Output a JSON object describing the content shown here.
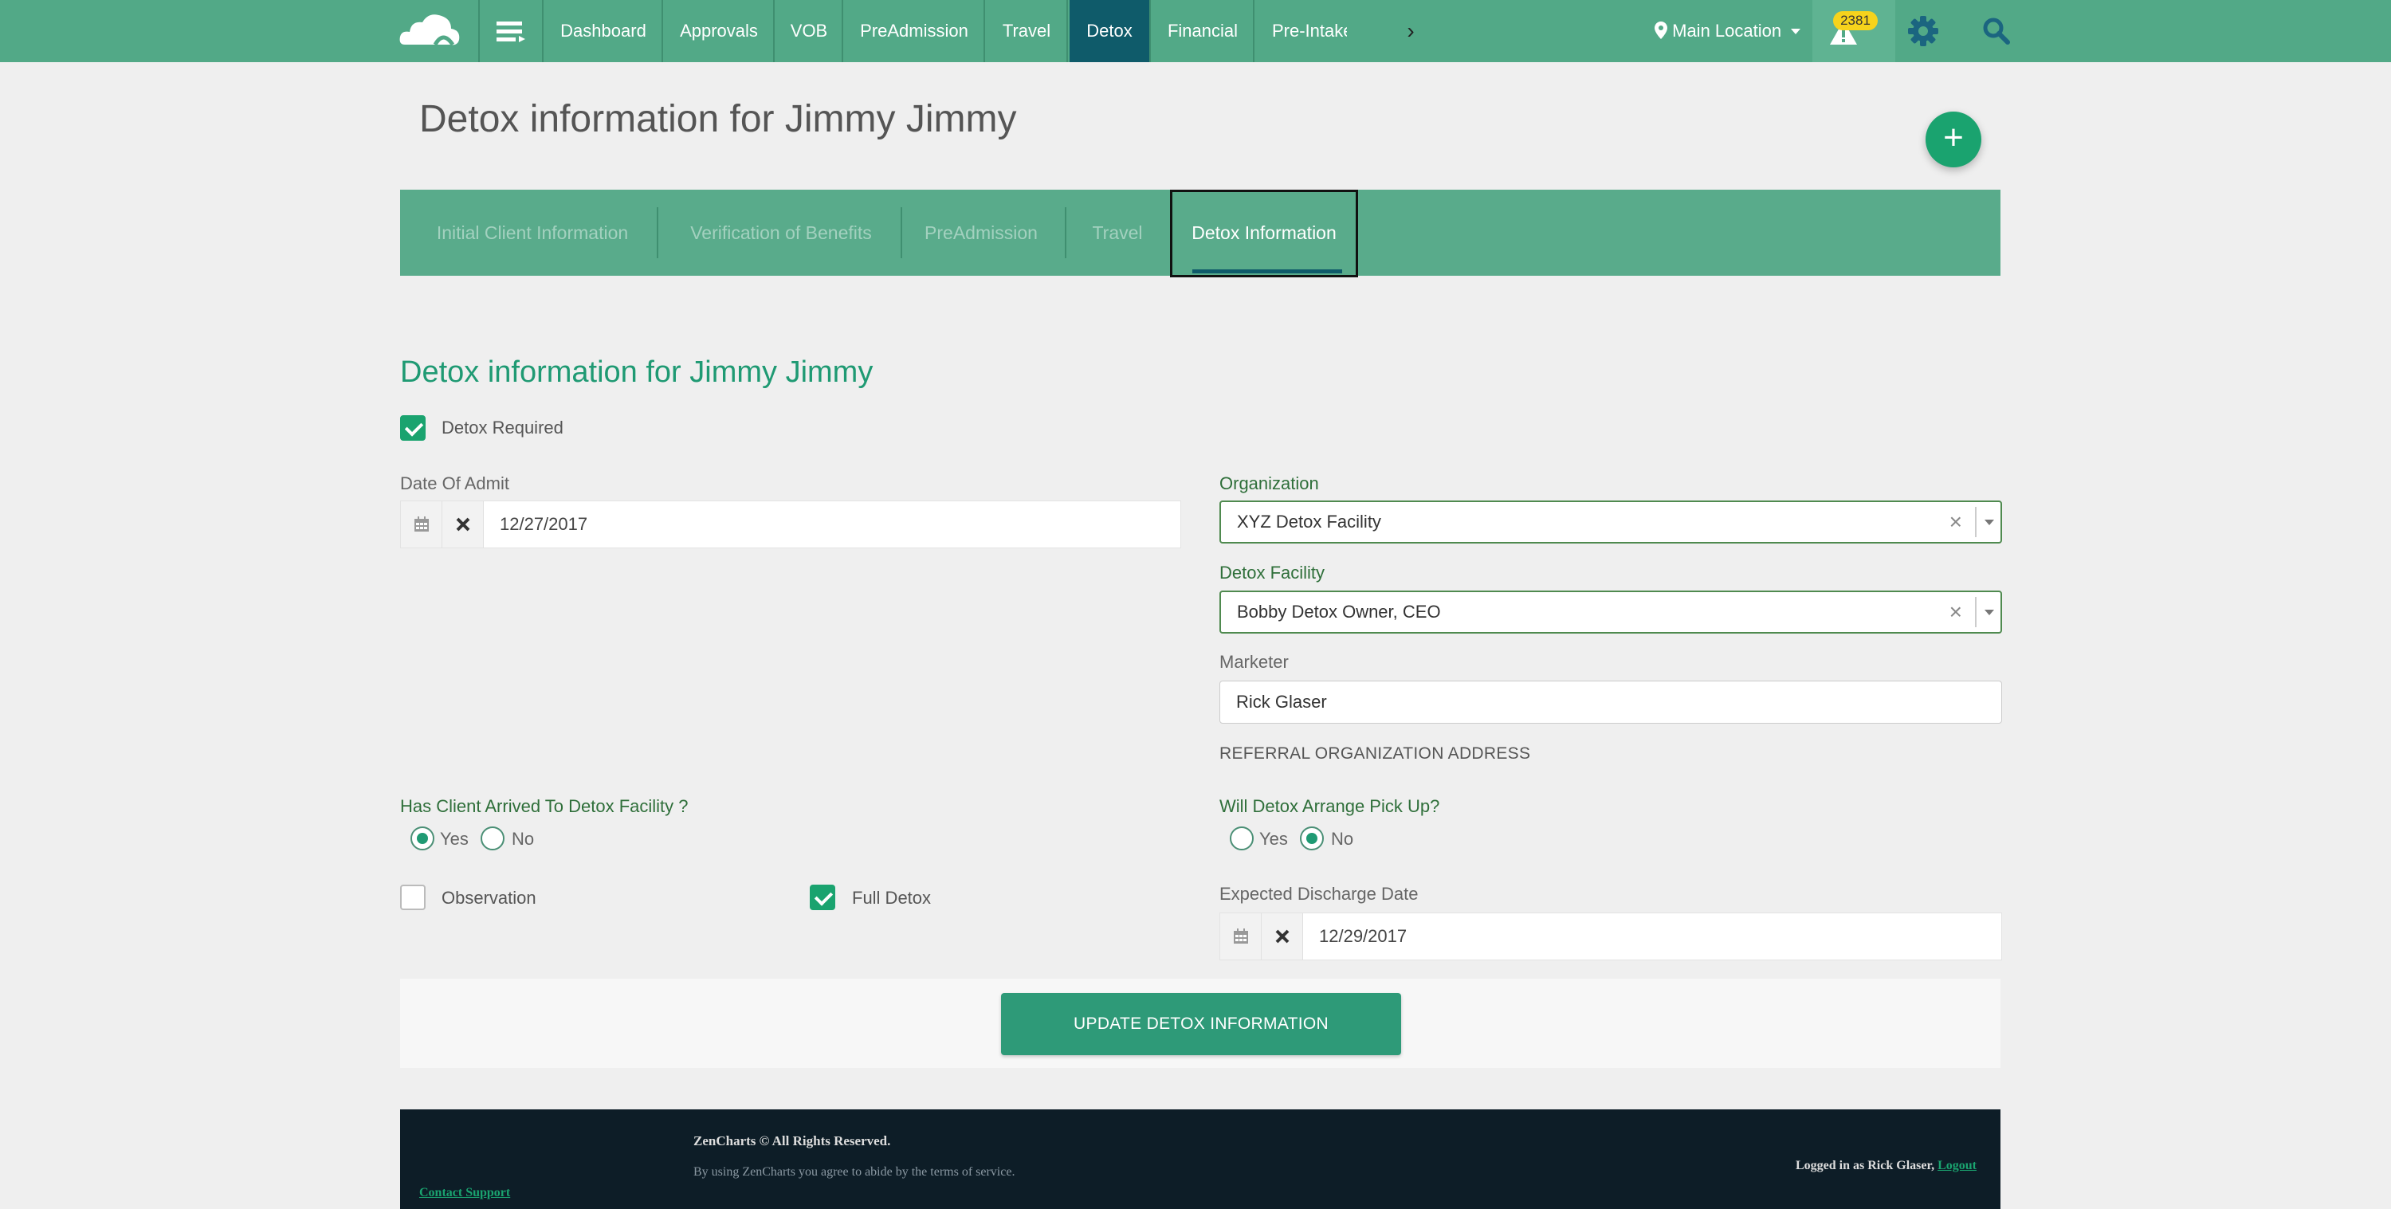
{
  "topbar": {
    "logo_icon": "cloud-logo-icon",
    "menu_icon": "menu-toggle-icon",
    "nav_items": [
      "Dashboard",
      "Approvals",
      "VOB",
      "PreAdmission",
      "Travel",
      "Detox",
      "Financial",
      "Pre-Intake"
    ],
    "active_item": "Detox",
    "more_glyph": "›",
    "location": "Main Location",
    "alert_count": "2381",
    "colors": {
      "bar": "#52a987",
      "active": "#0f5b6a",
      "badge": "#f6d31c"
    }
  },
  "page": {
    "title": "Detox information for Jimmy Jimmy",
    "fab_label": "+"
  },
  "tabs": [
    {
      "label": "Initial Client Information"
    },
    {
      "label": "Verification of Benefits"
    },
    {
      "label": "PreAdmission"
    },
    {
      "label": "Travel"
    },
    {
      "label": "Detox Information"
    }
  ],
  "form": {
    "section_title": "Detox information for Jimmy Jimmy",
    "detox_required": {
      "label": "Detox Required",
      "checked": true
    },
    "date_of_admit": {
      "label": "Date Of Admit",
      "value": "12/27/2017"
    },
    "organization": {
      "label": "Organization",
      "value": "XYZ Detox Facility"
    },
    "detox_facility": {
      "label": "Detox Facility",
      "value": "Bobby Detox Owner, CEO"
    },
    "marketer": {
      "label": "Marketer",
      "value": "Rick Glaser"
    },
    "referral_address_label": "REFERRAL ORGANIZATION ADDRESS",
    "arrived": {
      "label": "Has Client Arrived To Detox Facility ?",
      "yes": "Yes",
      "no": "No",
      "selected": "Yes"
    },
    "pickup": {
      "label": "Will Detox Arrange Pick Up?",
      "yes": "Yes",
      "no": "No",
      "selected": "No"
    },
    "observation": {
      "label": "Observation",
      "checked": false
    },
    "full_detox": {
      "label": "Full Detox",
      "checked": true
    },
    "expected_discharge": {
      "label": "Expected Discharge Date",
      "value": "12/29/2017"
    },
    "clear_glyph": "×",
    "submit_label": "UPDATE DETOX INFORMATION"
  },
  "footer": {
    "copyright": "ZenCharts © All Rights Reserved.",
    "terms": "By using ZenCharts you agree to abide by the terms of service.",
    "support": "Contact Support",
    "logged_in": "Logged in as Rick Glaser,",
    "logout": "Logout"
  }
}
